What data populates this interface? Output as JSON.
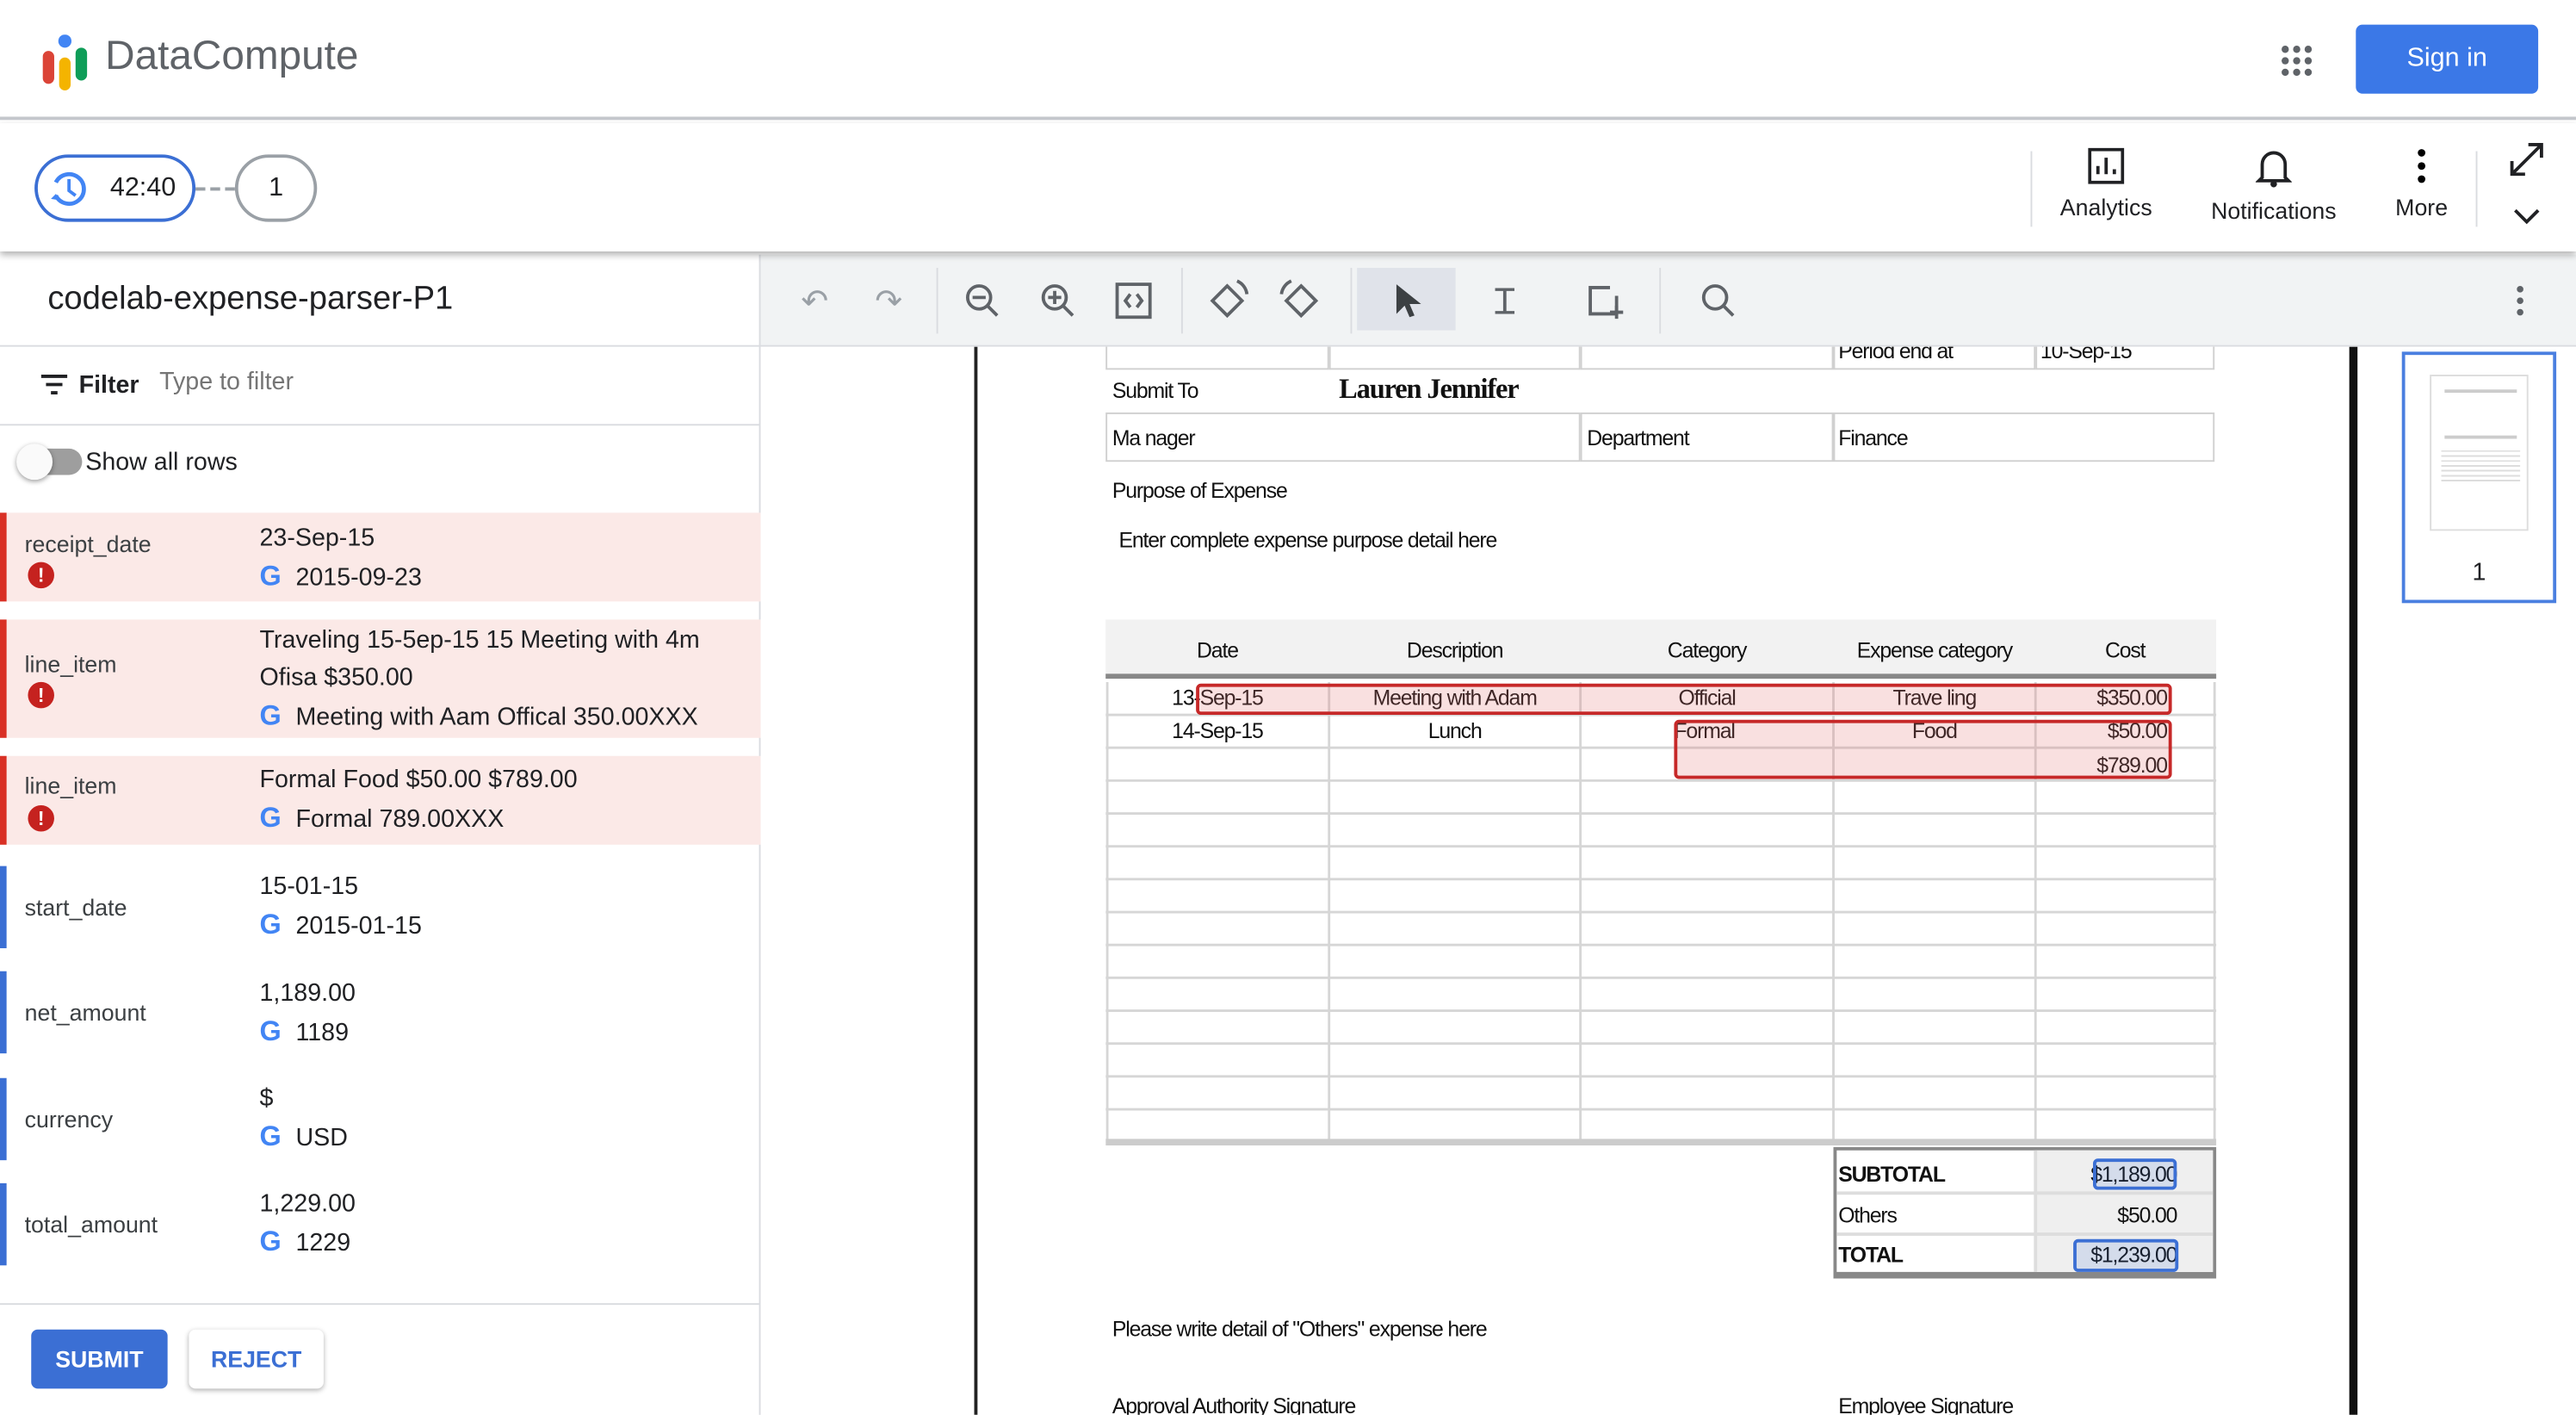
{
  "app": {
    "name": "DataCompute",
    "sign_in": "Sign in",
    "colors": {
      "accent": "#3b78e7",
      "error": "#d93025"
    }
  },
  "progress": {
    "timer": "42:40",
    "step": "1"
  },
  "actions": [
    {
      "label": "Analytics",
      "icon": "analytics-icon"
    },
    {
      "label": "Notifications",
      "icon": "bell-icon"
    },
    {
      "label": "More",
      "icon": "more-vert-icon"
    }
  ],
  "panel": {
    "title": "codelab-expense-parser-P1",
    "filter_label": "Filter",
    "filter_placeholder": "Type to filter",
    "show_all_rows": "Show all rows",
    "fields": [
      {
        "name": "receipt_date",
        "raw": "23-Sep-15",
        "normalized": "2015-09-23",
        "error": true
      },
      {
        "name": "line_item",
        "raw": "Traveling 15-5ep-15 15 Meeting with 4m Ofisa $350.00",
        "normalized": "Meeting with Aam Offical 350.00XXX",
        "error": true
      },
      {
        "name": "line_item",
        "raw": "Formal Food $50.00 $789.00",
        "normalized": "Formal 789.00XXX",
        "error": true
      },
      {
        "name": "start_date",
        "raw": "15-01-15",
        "normalized": "2015-01-15",
        "error": false
      },
      {
        "name": "net_amount",
        "raw": "1,189.00",
        "normalized": "1189",
        "error": false
      },
      {
        "name": "currency",
        "raw": "$",
        "normalized": "USD",
        "error": false
      },
      {
        "name": "total_amount",
        "raw": "1,229.00",
        "normalized": "1229",
        "error": false
      }
    ],
    "submit": "SUBMIT",
    "reject": "REJECT"
  },
  "document": {
    "period_end_label": "Period end at",
    "period_end_value": "10-Sep-15",
    "submit_to_label": "Submit To",
    "submit_to_value": "Lauren Jennifer",
    "manager_label": "Ma nager",
    "department_label": "Department",
    "department_value": "Finance",
    "purpose_label": "Purpose of Expense",
    "purpose_detail": "Enter complete expense  purpose detail here",
    "table_headers": [
      "Date",
      "Description",
      "Category",
      "Expense category",
      "Cost"
    ],
    "rows": [
      [
        "13-Sep-15",
        "Meeting with Adam",
        "Official",
        "Trave ling",
        "$350.00"
      ],
      [
        "14-Sep-15",
        "Lunch",
        "Formal",
        "Food",
        "$50.00"
      ],
      [
        "",
        "",
        "",
        "",
        "$789.00"
      ]
    ],
    "subtotal_label": "SUBTOTAL",
    "subtotal_value": "$1,189.00",
    "others_label": "Others",
    "others_value": "$50.00",
    "total_label": "TOTAL",
    "total_value": "$1,239.00",
    "others_note": "Please write detail of \"Others\" expense here",
    "approval_sig": "Approval Authority Signature",
    "employee_sig": "Employee Signature"
  },
  "thumbnail": {
    "page_label": "1"
  }
}
